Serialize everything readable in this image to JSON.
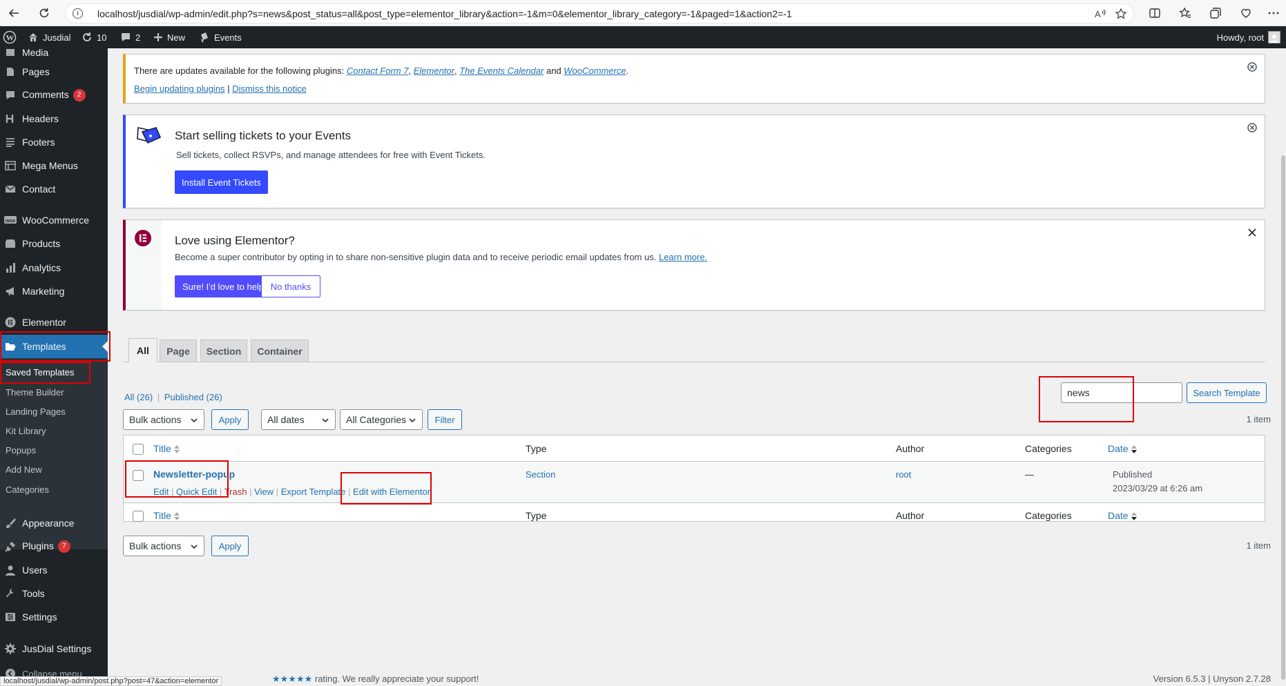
{
  "browser": {
    "url": "localhost/jusdial/wp-admin/edit.php?s=news&post_status=all&post_type=elementor_library&action=-1&m=0&elementor_library_category=-1&paged=1&action2=-1"
  },
  "admin_bar": {
    "site_name": "Jusdial",
    "updates_count": "10",
    "comments_count": "2",
    "new_label": "New",
    "events_label": "Events",
    "howdy": "Howdy, root"
  },
  "sidebar": {
    "media_partial": "Media",
    "items": [
      {
        "label": "Pages"
      },
      {
        "label": "Comments",
        "badge": "2"
      },
      {
        "label": "Headers"
      },
      {
        "label": "Footers"
      },
      {
        "label": "Mega Menus"
      },
      {
        "label": "Contact"
      },
      {
        "label": "WooCommerce"
      },
      {
        "label": "Products"
      },
      {
        "label": "Analytics"
      },
      {
        "label": "Marketing"
      },
      {
        "label": "Elementor"
      },
      {
        "label": "Templates"
      }
    ],
    "submenu": [
      "Saved Templates",
      "Theme Builder",
      "Landing Pages",
      "Kit Library",
      "Popups",
      "Add New",
      "Categories"
    ],
    "lower_items": [
      {
        "label": "Appearance"
      },
      {
        "label": "Plugins",
        "badge": "7"
      },
      {
        "label": "Users"
      },
      {
        "label": "Tools"
      },
      {
        "label": "Settings"
      },
      {
        "label": "JusDial Settings"
      },
      {
        "label": "Collapse menu"
      }
    ]
  },
  "notices": {
    "updates": {
      "prefix": "There are updates available for the following plugins:",
      "plugins": [
        "Contact Form 7",
        "Elementor",
        "The Events Calendar",
        "WooCommerce"
      ],
      "sep1": ",",
      "and": "and",
      "end": ".",
      "begin_link": "Begin updating plugins",
      "divider": "|",
      "dismiss_link": "Dismiss this notice"
    },
    "tickets": {
      "title": "Start selling tickets to your Events",
      "text": "Sell tickets, collect RSVPs, and manage attendees for free with Event Tickets.",
      "button": "Install Event Tickets"
    },
    "elementor": {
      "title": "Love using Elementor?",
      "text": "Become a super contributor by opting in to share non-sensitive plugin data and to receive periodic email updates from us.",
      "learn_more": "Learn more.",
      "yes_button": "Sure! I'd love to help",
      "no_button": "No thanks"
    }
  },
  "tabs": [
    "All",
    "Page",
    "Section",
    "Container"
  ],
  "filters": {
    "all_link": "All (26)",
    "sep": "|",
    "published_link": "Published (26)",
    "search_value": "news",
    "search_button": "Search Template",
    "bulk_actions": "Bulk actions",
    "apply": "Apply",
    "all_dates": "All dates",
    "all_categories": "All Categories",
    "filter_button": "Filter",
    "items_count": "1 item"
  },
  "table": {
    "headers": {
      "title": "Title",
      "type": "Type",
      "author": "Author",
      "categories": "Categories",
      "date": "Date"
    },
    "row": {
      "title": "Newsletter-popup",
      "actions": {
        "edit": "Edit",
        "quick_edit": "Quick Edit",
        "trash": "Trash",
        "view": "View",
        "export": "Export Template",
        "edit_elementor": "Edit with Elementor",
        "sep": "|"
      },
      "type": "Section",
      "author": "root",
      "categories": "—",
      "status": "Published",
      "date": "2023/03/29 at 6:26 am"
    }
  },
  "footer": {
    "thanks_tail": "rating. We really appreciate your support!",
    "stars": "★★★★★",
    "version": "Version 6.5.3 | Unyson 2.7.28",
    "status_url": "localhost/jusdial/wp-admin/post.php?post=47&action=elementor"
  },
  "colors": {
    "accent": "#2271b1",
    "elementor_blue": "#3858e9",
    "elementor_red": "#92003b",
    "highlight_red": "#e00000",
    "admin_dark": "#1d2327"
  }
}
